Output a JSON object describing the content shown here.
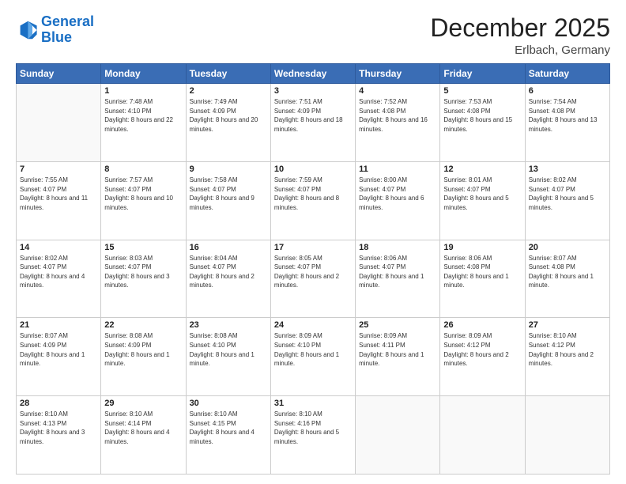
{
  "header": {
    "logo": {
      "line1": "General",
      "line2": "Blue"
    },
    "title": "December 2025",
    "location": "Erlbach, Germany"
  },
  "weekdays": [
    "Sunday",
    "Monday",
    "Tuesday",
    "Wednesday",
    "Thursday",
    "Friday",
    "Saturday"
  ],
  "weeks": [
    [
      {
        "day": null
      },
      {
        "day": 1,
        "sunrise": "7:48 AM",
        "sunset": "4:10 PM",
        "daylight": "8 hours and 22 minutes."
      },
      {
        "day": 2,
        "sunrise": "7:49 AM",
        "sunset": "4:09 PM",
        "daylight": "8 hours and 20 minutes."
      },
      {
        "day": 3,
        "sunrise": "7:51 AM",
        "sunset": "4:09 PM",
        "daylight": "8 hours and 18 minutes."
      },
      {
        "day": 4,
        "sunrise": "7:52 AM",
        "sunset": "4:08 PM",
        "daylight": "8 hours and 16 minutes."
      },
      {
        "day": 5,
        "sunrise": "7:53 AM",
        "sunset": "4:08 PM",
        "daylight": "8 hours and 15 minutes."
      },
      {
        "day": 6,
        "sunrise": "7:54 AM",
        "sunset": "4:08 PM",
        "daylight": "8 hours and 13 minutes."
      }
    ],
    [
      {
        "day": 7,
        "sunrise": "7:55 AM",
        "sunset": "4:07 PM",
        "daylight": "8 hours and 11 minutes."
      },
      {
        "day": 8,
        "sunrise": "7:57 AM",
        "sunset": "4:07 PM",
        "daylight": "8 hours and 10 minutes."
      },
      {
        "day": 9,
        "sunrise": "7:58 AM",
        "sunset": "4:07 PM",
        "daylight": "8 hours and 9 minutes."
      },
      {
        "day": 10,
        "sunrise": "7:59 AM",
        "sunset": "4:07 PM",
        "daylight": "8 hours and 8 minutes."
      },
      {
        "day": 11,
        "sunrise": "8:00 AM",
        "sunset": "4:07 PM",
        "daylight": "8 hours and 6 minutes."
      },
      {
        "day": 12,
        "sunrise": "8:01 AM",
        "sunset": "4:07 PM",
        "daylight": "8 hours and 5 minutes."
      },
      {
        "day": 13,
        "sunrise": "8:02 AM",
        "sunset": "4:07 PM",
        "daylight": "8 hours and 5 minutes."
      }
    ],
    [
      {
        "day": 14,
        "sunrise": "8:02 AM",
        "sunset": "4:07 PM",
        "daylight": "8 hours and 4 minutes."
      },
      {
        "day": 15,
        "sunrise": "8:03 AM",
        "sunset": "4:07 PM",
        "daylight": "8 hours and 3 minutes."
      },
      {
        "day": 16,
        "sunrise": "8:04 AM",
        "sunset": "4:07 PM",
        "daylight": "8 hours and 2 minutes."
      },
      {
        "day": 17,
        "sunrise": "8:05 AM",
        "sunset": "4:07 PM",
        "daylight": "8 hours and 2 minutes."
      },
      {
        "day": 18,
        "sunrise": "8:06 AM",
        "sunset": "4:07 PM",
        "daylight": "8 hours and 1 minute."
      },
      {
        "day": 19,
        "sunrise": "8:06 AM",
        "sunset": "4:08 PM",
        "daylight": "8 hours and 1 minute."
      },
      {
        "day": 20,
        "sunrise": "8:07 AM",
        "sunset": "4:08 PM",
        "daylight": "8 hours and 1 minute."
      }
    ],
    [
      {
        "day": 21,
        "sunrise": "8:07 AM",
        "sunset": "4:09 PM",
        "daylight": "8 hours and 1 minute."
      },
      {
        "day": 22,
        "sunrise": "8:08 AM",
        "sunset": "4:09 PM",
        "daylight": "8 hours and 1 minute."
      },
      {
        "day": 23,
        "sunrise": "8:08 AM",
        "sunset": "4:10 PM",
        "daylight": "8 hours and 1 minute."
      },
      {
        "day": 24,
        "sunrise": "8:09 AM",
        "sunset": "4:10 PM",
        "daylight": "8 hours and 1 minute."
      },
      {
        "day": 25,
        "sunrise": "8:09 AM",
        "sunset": "4:11 PM",
        "daylight": "8 hours and 1 minute."
      },
      {
        "day": 26,
        "sunrise": "8:09 AM",
        "sunset": "4:12 PM",
        "daylight": "8 hours and 2 minutes."
      },
      {
        "day": 27,
        "sunrise": "8:10 AM",
        "sunset": "4:12 PM",
        "daylight": "8 hours and 2 minutes."
      }
    ],
    [
      {
        "day": 28,
        "sunrise": "8:10 AM",
        "sunset": "4:13 PM",
        "daylight": "8 hours and 3 minutes."
      },
      {
        "day": 29,
        "sunrise": "8:10 AM",
        "sunset": "4:14 PM",
        "daylight": "8 hours and 4 minutes."
      },
      {
        "day": 30,
        "sunrise": "8:10 AM",
        "sunset": "4:15 PM",
        "daylight": "8 hours and 4 minutes."
      },
      {
        "day": 31,
        "sunrise": "8:10 AM",
        "sunset": "4:16 PM",
        "daylight": "8 hours and 5 minutes."
      },
      {
        "day": null
      },
      {
        "day": null
      },
      {
        "day": null
      }
    ]
  ]
}
